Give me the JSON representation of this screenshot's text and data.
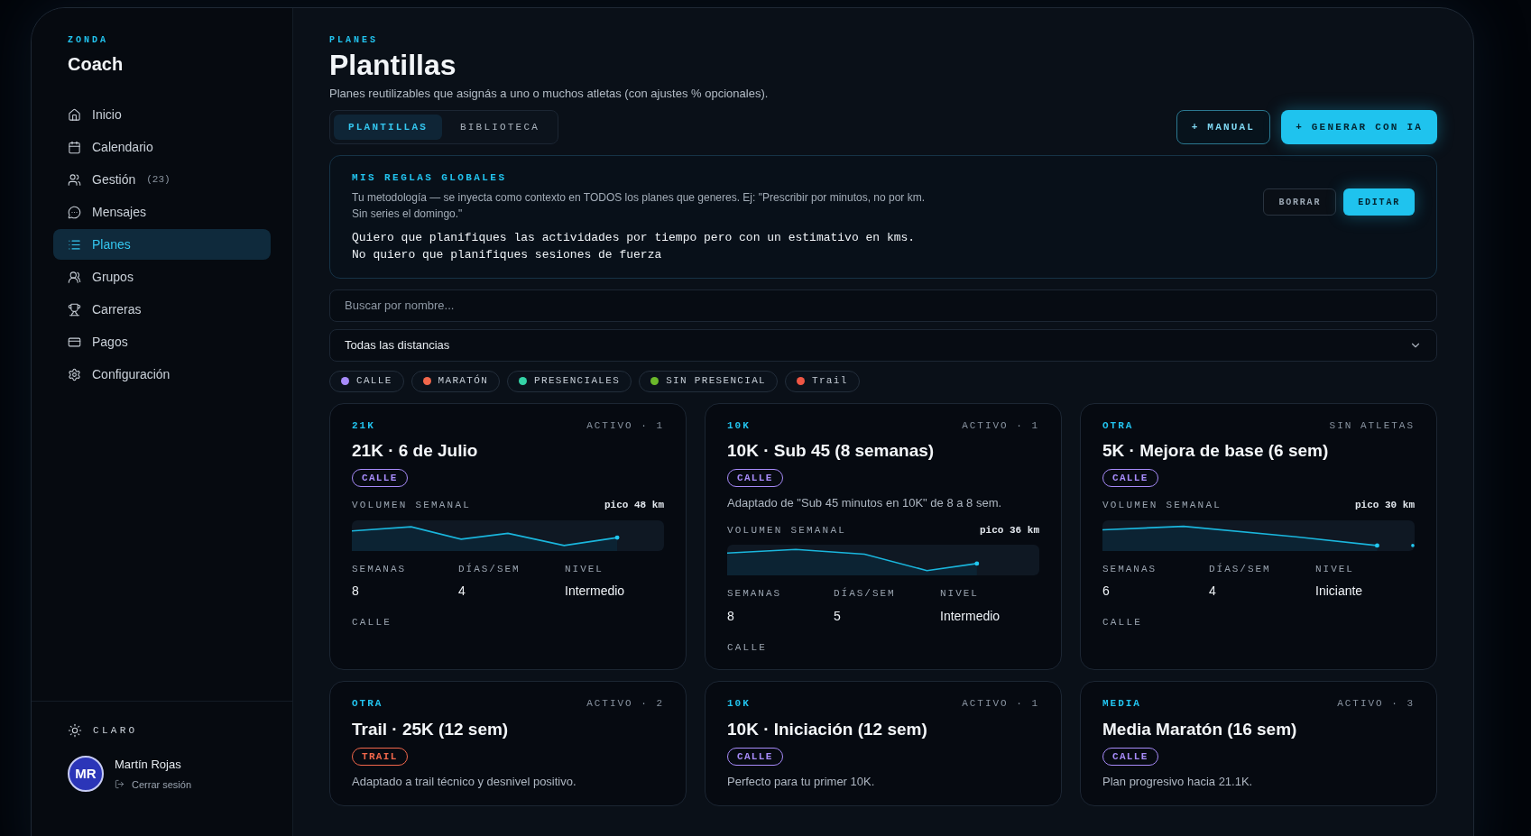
{
  "sidebar": {
    "brand_kicker": "ZONDA",
    "brand": "Coach",
    "items": [
      {
        "label": "Inicio",
        "selected": false
      },
      {
        "label": "Calendario",
        "selected": false
      },
      {
        "label": "Gestión",
        "count": "(23)",
        "selected": false
      },
      {
        "label": "Mensajes",
        "selected": false
      },
      {
        "label": "Planes",
        "selected": true
      },
      {
        "label": "Grupos",
        "selected": false
      },
      {
        "label": "Carreras",
        "selected": false
      },
      {
        "label": "Pagos",
        "selected": false
      },
      {
        "label": "Configuración",
        "selected": false
      }
    ],
    "theme_toggle": "CLARO",
    "user": {
      "initials": "MR",
      "name": "Martín Rojas",
      "logout": "Cerrar sesión"
    }
  },
  "header": {
    "kicker": "PLANES",
    "title": "Plantillas",
    "subtitle": "Planes reutilizables que asignás a uno o muchos atletas (con ajustes % opcionales)."
  },
  "tabs": [
    {
      "label": "PLANTILLAS",
      "selected": true
    },
    {
      "label": "BIBLIOTECA",
      "selected": false
    }
  ],
  "actions": [
    {
      "label": "+ MANUAL",
      "kind": "outline"
    },
    {
      "label": "+ GENERAR CON IA",
      "kind": "primary"
    }
  ],
  "rules": {
    "title": "MIS REGLAS GLOBALES",
    "help": "Tu metodología — se inyecta como contexto en TODOS los planes que generes. Ej: \"Prescribir por minutos, no por km. Sin series el domingo.\"",
    "lines": [
      "Quiero que planifiques las actividades por tiempo pero con un estimativo en kms.",
      "No quiero que planifiques sesiones de fuerza"
    ],
    "actions": [
      {
        "label": "BORRAR",
        "kind": "ghost"
      },
      {
        "label": "EDITAR",
        "kind": "primary"
      }
    ]
  },
  "search": {
    "placeholder": "Buscar por nombre..."
  },
  "distance_filter": {
    "value": "Todas las distancias"
  },
  "chips": [
    {
      "label": "CALLE",
      "color": "#a78bfa"
    },
    {
      "label": "MARATÓN",
      "color": "#f2674b"
    },
    {
      "label": "PRESENCIALES",
      "color": "#34d3a6"
    },
    {
      "label": "SIN PRESENCIAL",
      "color": "#6bb82a"
    },
    {
      "label": "Trail",
      "color": "#ef5644"
    }
  ],
  "cards": [
    {
      "category": "21K",
      "status": "ACTIVO · 1",
      "title": "21K · 6 de Julio",
      "tag": {
        "label": "CALLE",
        "color": "#a78bfa"
      },
      "volume": {
        "label": "VOLUMEN SEMANAL",
        "peak": "pico 48 km"
      },
      "stats": [
        {
          "label": "SEMANAS",
          "value": "8"
        },
        {
          "label": "DÍAS/SEM",
          "value": "4"
        },
        {
          "label": "NIVEL",
          "value": "Intermedio"
        }
      ],
      "footer": "CALLE"
    },
    {
      "category": "10K",
      "status": "ACTIVO · 1",
      "title": "10K · Sub 45 (8 semanas)",
      "tag": {
        "label": "CALLE",
        "color": "#a78bfa"
      },
      "description": "Adaptado de \"Sub 45 minutos en 10K\" de 8 a 8 sem.",
      "volume": {
        "label": "VOLUMEN SEMANAL",
        "peak": "pico 36 km"
      },
      "stats": [
        {
          "label": "SEMANAS",
          "value": "8"
        },
        {
          "label": "DÍAS/SEM",
          "value": "5"
        },
        {
          "label": "NIVEL",
          "value": "Intermedio"
        }
      ],
      "footer": "CALLE"
    },
    {
      "category": "OTRA",
      "status": "SIN ATLETAS",
      "title": "5K · Mejora de base (6 sem)",
      "tag": {
        "label": "CALLE",
        "color": "#a78bfa"
      },
      "volume": {
        "label": "VOLUMEN SEMANAL",
        "peak": "pico 30 km"
      },
      "stats": [
        {
          "label": "SEMANAS",
          "value": "6"
        },
        {
          "label": "DÍAS/SEM",
          "value": "4"
        },
        {
          "label": "NIVEL",
          "value": "Iniciante"
        }
      ],
      "footer": "CALLE"
    },
    {
      "category": "OTRA",
      "status": "ACTIVO · 2",
      "title": "Trail · 25K (12 sem)",
      "tag": {
        "label": "TRAIL",
        "color": "#f2674b"
      },
      "description": "Adaptado a trail técnico y desnivel positivo."
    },
    {
      "category": "10K",
      "status": "ACTIVO · 1",
      "title": "10K · Iniciación (12 sem)",
      "tag": {
        "label": "CALLE",
        "color": "#a78bfa"
      },
      "description": "Perfecto para tu primer 10K."
    },
    {
      "category": "MEDIA",
      "status": "ACTIVO · 3",
      "title": "Media Maratón (16 sem)",
      "tag": {
        "label": "CALLE",
        "color": "#a78bfa"
      },
      "description": "Plan progresivo hacia 21.1K."
    }
  ]
}
